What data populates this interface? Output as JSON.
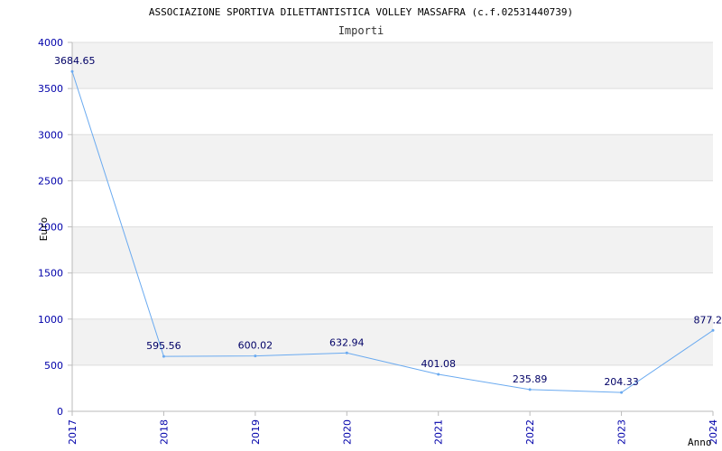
{
  "chart_data": {
    "type": "line",
    "title": "ASSOCIAZIONE SPORTIVA DILETTANTISTICA VOLLEY MASSAFRA (c.f.02531440739)",
    "subtitle": "Importi",
    "xlabel": "Anno",
    "ylabel": "Euro",
    "categories": [
      "2017",
      "2018",
      "2019",
      "2020",
      "2021",
      "2022",
      "2023",
      "2024"
    ],
    "series": [
      {
        "values": [
          3684.65,
          595.56,
          600.02,
          632.94,
          401.08,
          235.89,
          204.33,
          877.2
        ],
        "labels": [
          "3684.65",
          "595.56",
          "600.02",
          "632.94",
          "401.08",
          "235.89",
          "204.33",
          "877.2"
        ]
      }
    ],
    "ylim": [
      0,
      4000
    ],
    "yticks": [
      "0",
      "500",
      "1000",
      "1500",
      "2000",
      "2500",
      "3000",
      "3500",
      "4000"
    ],
    "grid": true,
    "colors": {
      "line": "#6aaaf0",
      "tick_text": "#0000aa",
      "band": "#f2f2f2",
      "gridline": "#dddddd",
      "axis": "#bbbbbb"
    }
  }
}
